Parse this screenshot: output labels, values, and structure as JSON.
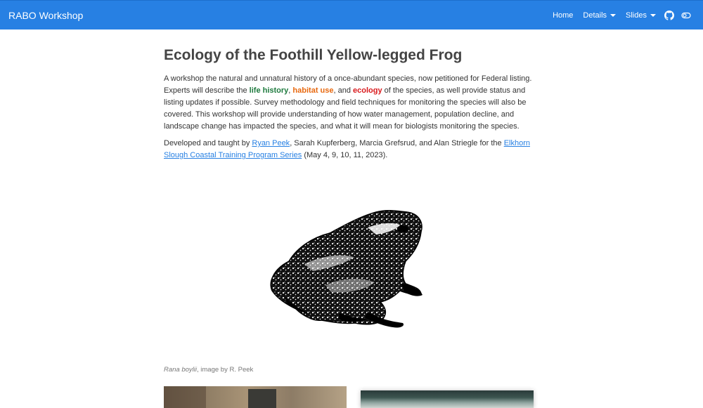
{
  "navbar": {
    "brand": "RABO Workshop",
    "home": "Home",
    "details": "Details",
    "slides": "Slides",
    "icons": [
      "github-icon",
      "toggle-icon"
    ]
  },
  "main": {
    "title": "Ecology of the Foothill Yellow-legged Frog",
    "intro_1": "A workshop the natural and unnatural history of a once-abundant species, now petitioned for Federal listing. Experts will describe the ",
    "life_history": "life history",
    "sep_1": ", ",
    "habitat_use": "habitat use",
    "sep_2": ", and ",
    "ecology": "ecology",
    "intro_2": " of the species, as well provide status and listing updates if possible. Survey methodology and field techniques for monitoring the species will also be covered. This workshop will provide understanding of how water management, population decline, and landscape change has impacted the species, and what it will mean for biologists monitoring the species.",
    "credit_1": "Developed and taught by ",
    "credit_link_1": "Ryan Peek",
    "credit_2": ", Sarah Kupferberg, Marcia Grefsrud, and Alan Striegle for the ",
    "credit_link_2": "Elkhorn Slough Coastal Training Program Series",
    "credit_3": " (May 4, 9, 10, 11, 2023).",
    "caption_species": "Rana boylii",
    "caption_rest": ", image by R. Peek"
  },
  "colors": {
    "navbar": "#2780e3",
    "life_history": "#1e7a3e",
    "habitat_use": "#e8680e",
    "ecology": "#d9191c",
    "link": "#2780e3"
  }
}
